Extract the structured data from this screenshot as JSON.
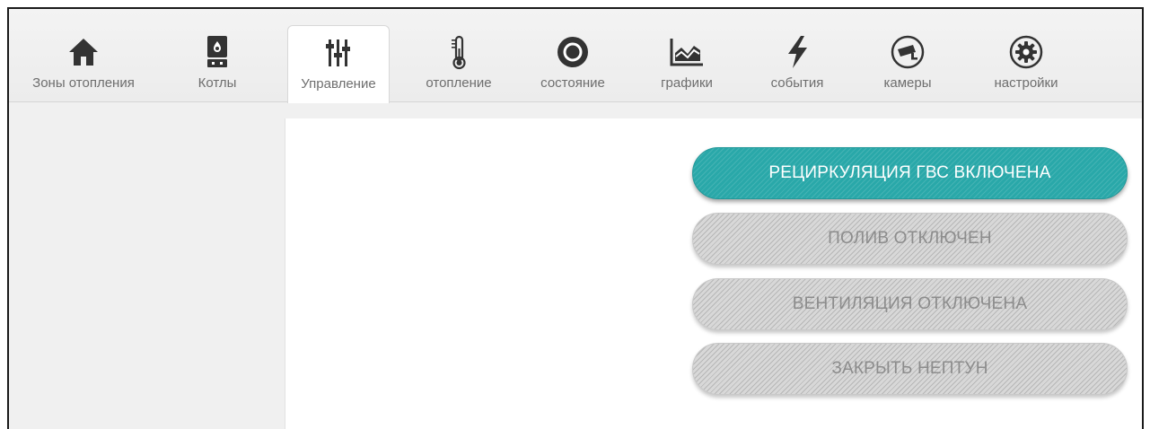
{
  "nav": {
    "items": [
      {
        "label": "Зоны отопления",
        "icon": "home-icon"
      },
      {
        "label": "Котлы",
        "icon": "boiler-icon"
      },
      {
        "label": "Управление",
        "icon": "sliders-icon",
        "active": true
      },
      {
        "label": "отопление",
        "icon": "thermometer-icon"
      },
      {
        "label": "состояние",
        "icon": "circle-status-icon"
      },
      {
        "label": "графики",
        "icon": "area-chart-icon"
      },
      {
        "label": "события",
        "icon": "lightning-icon"
      },
      {
        "label": "камеры",
        "icon": "camera-icon"
      },
      {
        "label": "настройки",
        "icon": "gear-icon"
      }
    ]
  },
  "controls": {
    "buttons": [
      {
        "label": "РЕЦИРКУЛЯЦИЯ ГВС ВКЛЮЧЕНА",
        "state": "on"
      },
      {
        "label": "ПОЛИВ ОТКЛЮЧЕН",
        "state": "off"
      },
      {
        "label": "ВЕНТИЛЯЦИЯ ОТКЛЮЧЕНА",
        "state": "off"
      },
      {
        "label": "ЗАКРЫТЬ НЕПТУН",
        "state": "off"
      }
    ]
  },
  "colors": {
    "accent_on": "#29a8a9",
    "button_off": "#d8d8d8",
    "icon_dark": "#3a3a3a"
  }
}
